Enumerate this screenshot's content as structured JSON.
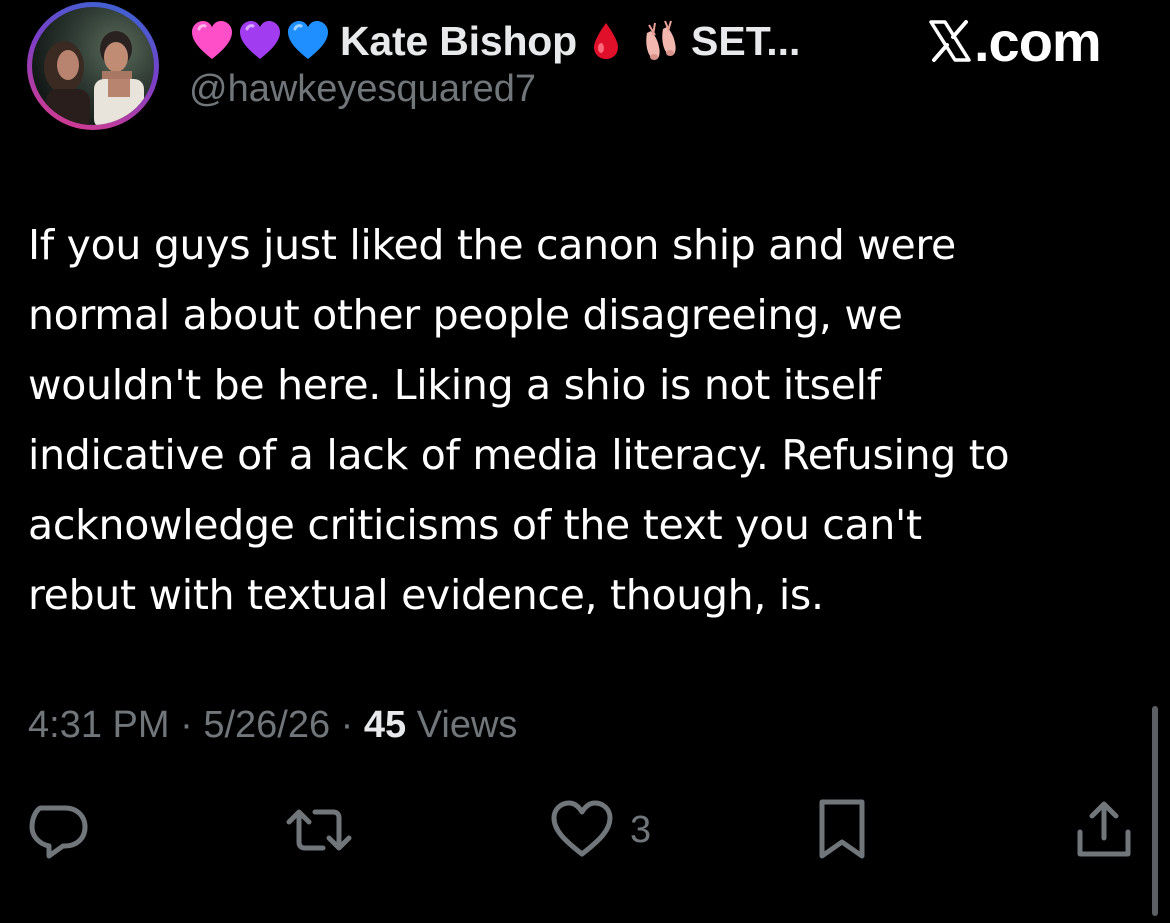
{
  "author": {
    "display_name": "Kate Bishop",
    "name_suffix": "SET...",
    "handle": "@hawkeyesquared7",
    "emoji_icons": [
      "pink-heart-icon",
      "purple-heart-icon",
      "blue-heart-icon",
      "drop-of-blood-icon",
      "ballet-shoes-icon"
    ]
  },
  "brand": {
    "logo_text": ".com"
  },
  "tweet": {
    "lines": [
      "If you guys just liked the canon ship and were",
      "normal about other people disagreeing, we",
      "wouldn't be here. Liking a shio is not itself",
      "indicative of a lack of media literacy. Refusing to",
      "acknowledge criticisms of the text you can't",
      "rebut with textual evidence, though, is."
    ]
  },
  "meta": {
    "time": "4:31 PM",
    "separator": "·",
    "date": "5/26/26",
    "views_count": "45",
    "views_label": "Views"
  },
  "actions": {
    "like_count": "3"
  },
  "colors": {
    "background": "#000000",
    "text_primary": "#ffffff",
    "text_secondary": "#71767b",
    "pink_heart": "#ff4fc8",
    "purple_heart": "#a23cf0",
    "blue_heart": "#1f8fff",
    "drop_red": "#e0102a"
  }
}
